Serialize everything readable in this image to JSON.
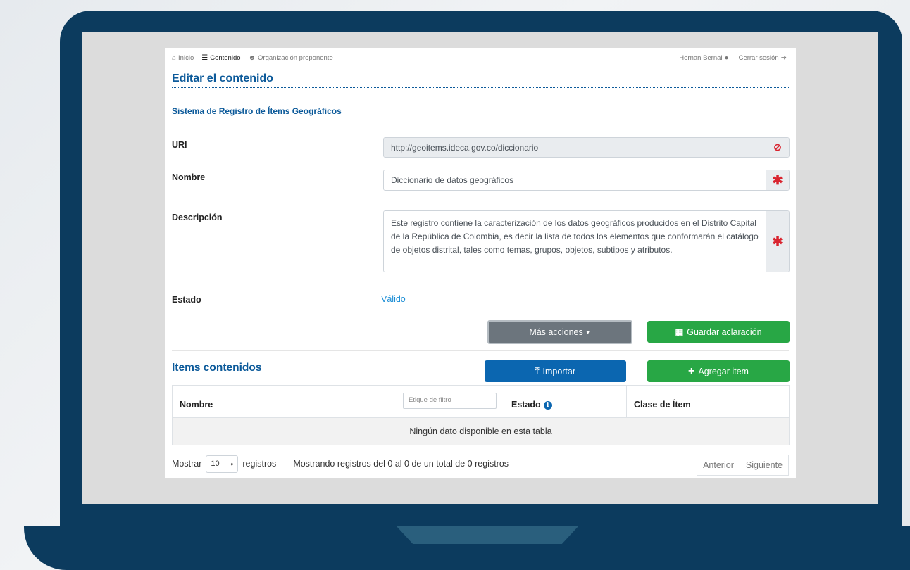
{
  "nav": {
    "inicio": "Inicio",
    "contenido": "Contenido",
    "organizacion": "Organización proponente",
    "user": "Hernan Bernal",
    "logout": "Cerrar sesión"
  },
  "page": {
    "title": "Editar el contenido",
    "section": "Sistema de Registro de Ítems Geográficos"
  },
  "form": {
    "uri_label": "URI",
    "uri_value": "http://geoitems.ideca.gov.co/diccionario",
    "nombre_label": "Nombre",
    "nombre_value": "Diccionario de datos geográficos",
    "descripcion_label": "Descripción",
    "descripcion_value": "Este registro contiene la caracterización de los datos geográficos producidos en el Distrito Capital de la República de Colombia, es decir la lista de todos los elementos que conformarán el catálogo de objetos distrital, tales como temas, grupos, objetos, subtipos y atributos.",
    "estado_label": "Estado",
    "estado_value": "Válido"
  },
  "actions": {
    "mas_acciones": "Más acciones",
    "guardar": "Guardar aclaración",
    "importar": "Importar",
    "agregar": "Agregar item"
  },
  "items": {
    "title": "Items contenidos",
    "columns": {
      "nombre": "Nombre",
      "filter_placeholder": "Etique de filtro",
      "estado": "Estado",
      "clase": "Clase de Ítem"
    },
    "empty": "Ningún dato disponible en esta tabla",
    "mostrar": "Mostrar",
    "length_value": "10",
    "registros": "registros",
    "info": "Mostrando registros del 0 al 0 de un total de 0 registros",
    "anterior": "Anterior",
    "siguiente": "Siguiente"
  }
}
